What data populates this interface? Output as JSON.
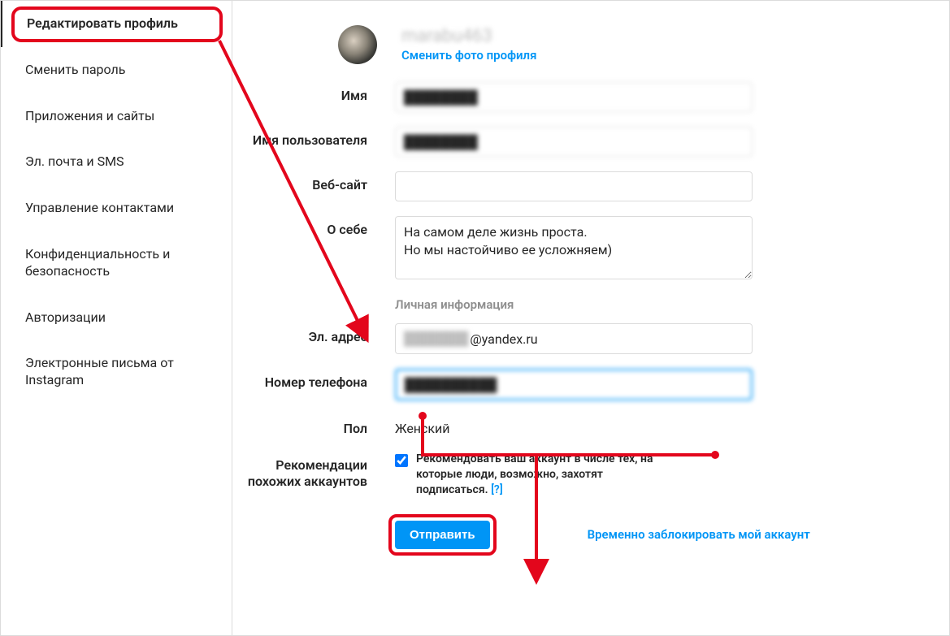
{
  "sidebar": {
    "items": [
      {
        "label": "Редактировать профиль",
        "active": true
      },
      {
        "label": "Сменить пароль"
      },
      {
        "label": "Приложения и сайты"
      },
      {
        "label": "Эл. почта и SMS"
      },
      {
        "label": "Управление контактами"
      },
      {
        "label": "Конфиденциальность и безопасность"
      },
      {
        "label": "Авторизации"
      },
      {
        "label": "Электронные письма от Instagram"
      }
    ]
  },
  "profile": {
    "username_masked": "marabu463",
    "change_photo": "Сменить фото профиля"
  },
  "labels": {
    "name": "Имя",
    "username": "Имя пользователя",
    "website": "Веб-сайт",
    "bio": "О себе",
    "private_section": "Личная информация",
    "email": "Эл. адрес",
    "phone": "Номер телефона",
    "gender": "Пол",
    "recommendations": "Рекомендации похожих аккаунтов"
  },
  "values": {
    "name_masked": "████████",
    "username_masked": "████████",
    "website": "",
    "bio": "На самом деле жизнь проста.\nНо мы настойчиво ее усложняем)",
    "email_masked_local": "███████",
    "email_domain": "@yandex.ru",
    "phone_masked": "██████████",
    "gender": "Женский",
    "rec_checked": true,
    "rec_text": "Рекомендовать ваш аккаунт в числе тех, на которые люди, возможно, захотят подписаться.",
    "rec_help": "[?]"
  },
  "actions": {
    "submit": "Отправить",
    "disable_account": "Временно заблокировать мой аккаунт"
  }
}
